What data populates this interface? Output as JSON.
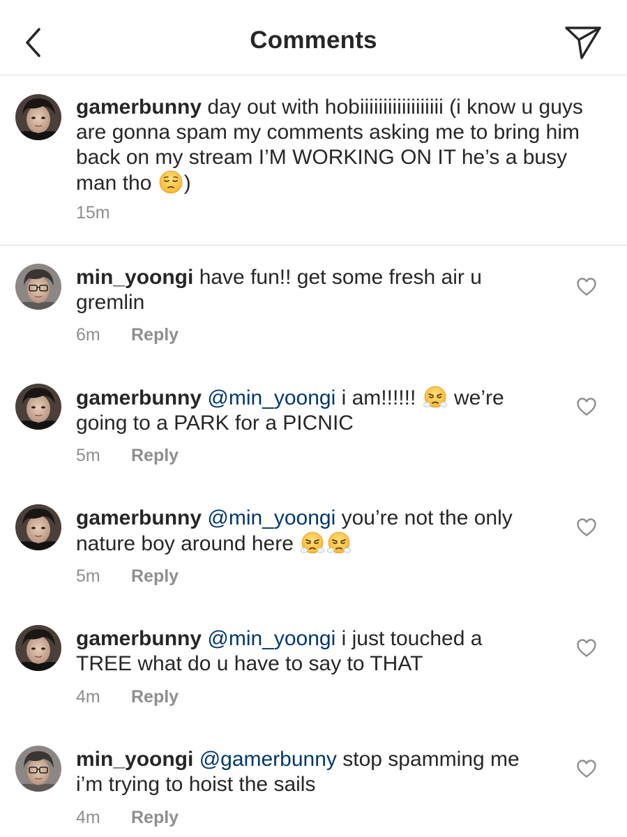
{
  "header": {
    "title": "Comments"
  },
  "caption": {
    "username": "gamerbunny",
    "text_before_emoji": "day out with hobiiiiiiiiiiiiiiiiii (i know u guys are gonna spam my comments asking me to bring him back on my stream I’M WORKING ON IT he’s a busy man tho",
    "emoji": "pensive-face",
    "text_after_emoji": ")",
    "time": "15m"
  },
  "comments": [
    {
      "username": "min_yoongi",
      "mention": "",
      "text": "have fun!! get some fresh air u gremlin",
      "time": "6m",
      "reply_label": "Reply",
      "avatar": "avatar-min-yoongi"
    },
    {
      "username": "gamerbunny",
      "mention": "@min_yoongi",
      "text_before_emoji": "i am!!!!!!",
      "emoji": "face-with-steam-from-nose",
      "text_after_emoji": "we’re going to a PARK for a PICNIC",
      "time": "5m",
      "reply_label": "Reply",
      "avatar": "avatar-gamerbunny"
    },
    {
      "username": "gamerbunny",
      "mention": "@min_yoongi",
      "text": "you’re not the only nature boy around here",
      "emojis": [
        "face-with-steam-from-nose",
        "face-with-steam-from-nose"
      ],
      "time": "5m",
      "reply_label": "Reply",
      "avatar": "avatar-gamerbunny"
    },
    {
      "username": "gamerbunny",
      "mention": "@min_yoongi",
      "text": "i just touched a TREE what do u have to say to THAT",
      "time": "4m",
      "reply_label": "Reply",
      "avatar": "avatar-gamerbunny"
    },
    {
      "username": "min_yoongi",
      "mention": "@gamerbunny",
      "text": "stop spamming me i’m trying to hoist the sails",
      "time": "4m",
      "reply_label": "Reply",
      "avatar": "avatar-min-yoongi"
    }
  ],
  "colors": {
    "text": "#262626",
    "secondary": "#8e8e8e",
    "mention": "#00376b",
    "divider": "#dbdbdb"
  },
  "icons": {
    "back": "chevron-left-icon",
    "share": "paper-plane-icon",
    "like": "heart-outline-icon"
  }
}
